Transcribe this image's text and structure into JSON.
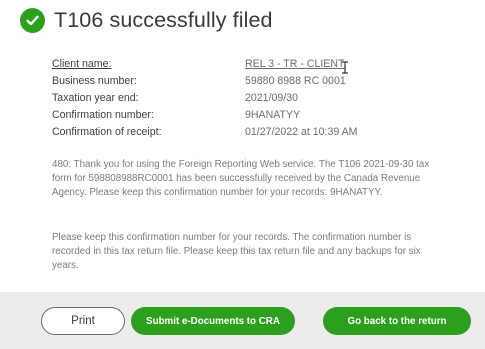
{
  "header": {
    "title": "T106 successfully filed",
    "icon": "check-circle-icon",
    "accent_color": "#2ca01c"
  },
  "details": {
    "rows": [
      {
        "label": "Client name:",
        "value": "REL 3 - TR - CLIENT"
      },
      {
        "label": "Business number:",
        "value": "59880 8988 RC 0001"
      },
      {
        "label": "Taxation year end:",
        "value": "2021/09/30"
      },
      {
        "label": "Confirmation number:",
        "value": "9HANATYY"
      },
      {
        "label": "Confirmation of receipt:",
        "value": "01/27/2022 at 10:39 AM"
      }
    ]
  },
  "messages": {
    "receipt": "480: Thank you for using the Foreign Reporting Web service. The T106 2021-09-30 tax form for 598808988RC0001 has been successfully received by the Canada Revenue Agency. Please keep this confirmation number for your records: 9HANATYY.",
    "keep": "Please keep this confirmation number for your records. The confirmation number is recorded in this tax return file. Please keep this tax return file and any backups for six years."
  },
  "footer": {
    "print_label": "Print",
    "submit_label": "Submit e-Documents to CRA",
    "back_label": "Go back to the return"
  }
}
